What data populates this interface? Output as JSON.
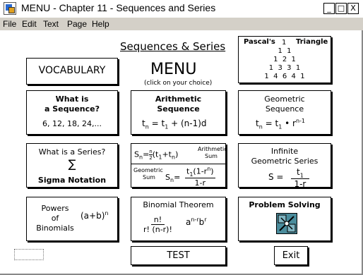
{
  "window": {
    "title": "MENU - Chapter 11 - Sequences and Series",
    "controls": [
      "_",
      "□",
      "X"
    ]
  },
  "menubar": [
    "File",
    "Edit",
    "Text",
    "Page",
    "Help"
  ],
  "header": {
    "title": "Sequences & Series",
    "menu_label": "MENU",
    "menu_hint": "(click on your choice)"
  },
  "pascal": {
    "title_left": "Pascal's",
    "title_one": "1",
    "title_right": "Triangle",
    "rows": [
      "1  1",
      "1  2  1",
      "1  3  3  1",
      "1  4  6  4  1"
    ]
  },
  "vocabulary": {
    "label": "VOCABULARY"
  },
  "sequence": {
    "line1": "What is",
    "line2": "a Sequence?",
    "example": "6, 12, 18, 24,..."
  },
  "arithmetic": {
    "line1": "Arithmetic",
    "line2": "Sequence",
    "formula_lhs": "t",
    "sub_n": "n",
    "eq": "= t",
    "sub_1": "1",
    "rest": "+ (n-1)d"
  },
  "geometric": {
    "line1": "Geometric",
    "line2": "Sequence",
    "t": "t",
    "sub_n": "n",
    "eq": "= t",
    "sub_1": "1",
    "bullet": "• r",
    "exp": "n-1"
  },
  "series": {
    "line1": "What is a Series?",
    "sigma": "∑",
    "label": "Sigma Notation"
  },
  "sums": {
    "arith_top": "Arithmetic",
    "arith_bottom": "Sum",
    "geo_top": "Geometric",
    "geo_bottom": "Sum",
    "S": "S",
    "n": "n",
    "eq": "=",
    "half_num": "n",
    "half_den": "2",
    "arith_rest": "(t",
    "one": "1",
    "plus_t": "+t",
    "close": ")",
    "geo_num": "t",
    "geo_num_rest": "(1-r",
    "geo_num_close": ")",
    "geo_den": "1-r"
  },
  "infinite": {
    "line1": "Infinite",
    "line2": "Geometric Series",
    "S": "S =",
    "num": "t",
    "sub": "1",
    "den": "1-r"
  },
  "binomials": {
    "line1": "Powers",
    "line2": "of",
    "line3": "Binomials",
    "expr": "(a+b)",
    "exp": "n"
  },
  "binomial_theorem": {
    "title": "Binomial Theorem",
    "num": "n!",
    "den": "r! (n-r)!",
    "a": "a",
    "a_exp": "n-r",
    "b": "b",
    "b_exp": "r"
  },
  "problem": {
    "label": "Problem Solving"
  },
  "buttons": {
    "test": "TEST",
    "exit": "Exit"
  },
  "colors": {
    "problem_icon": "#4a8c9c"
  }
}
